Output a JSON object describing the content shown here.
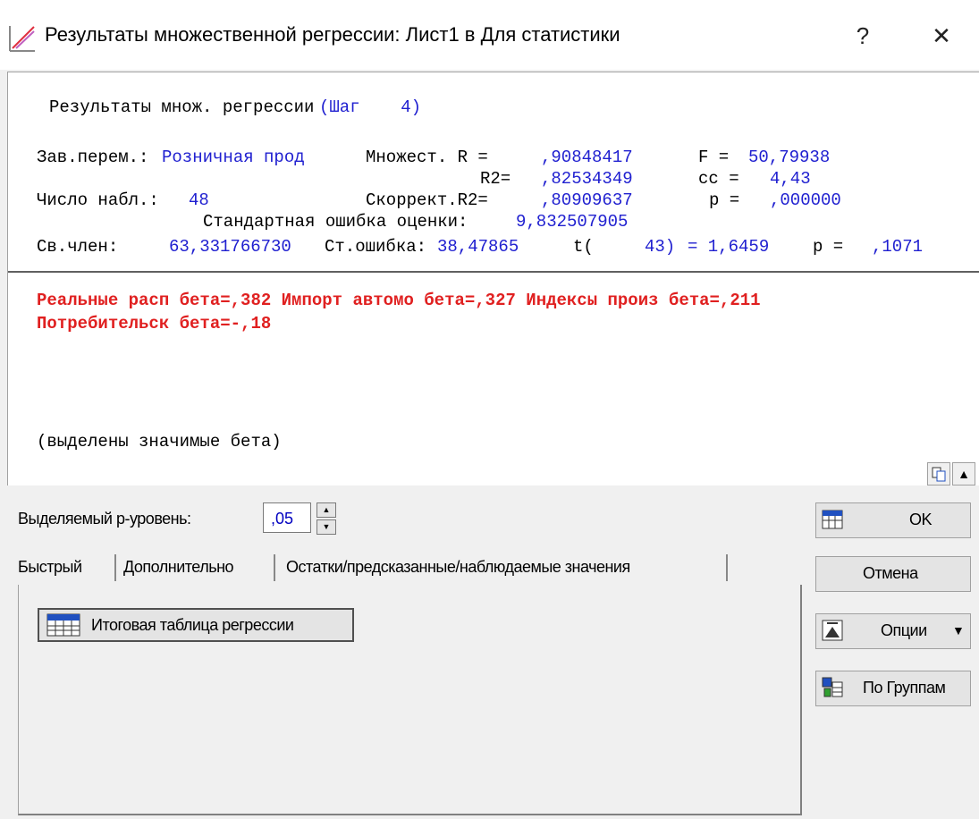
{
  "window": {
    "title": "Результаты множественной регрессии: Лист1 в Для статистики",
    "help_glyph": "?",
    "close_glyph": "✕"
  },
  "output": {
    "header": {
      "label": "Результаты множ. регрессии",
      "step": "(Шаг    4)"
    },
    "dep_var": {
      "label": "Зав.перем.:",
      "value": "Розничная прод"
    },
    "multiple_r": {
      "label": "Множест. R =",
      "value": ",90848417"
    },
    "f": {
      "label": "F =",
      "value": "50,79938"
    },
    "r2": {
      "label": "R2=",
      "value": ",82534349"
    },
    "df": {
      "label": "сс =",
      "value": "4,43"
    },
    "n": {
      "label": "Число набл.:",
      "value": "48"
    },
    "adj_r2": {
      "label": "Скоррект.R2=",
      "value": ",80909637"
    },
    "p": {
      "label": "p =",
      "value": ",000000"
    },
    "std_err_est": {
      "label": "Стандартная ошибка оценки:",
      "value": "9,832507905"
    },
    "intercept": {
      "label": "Св.член:",
      "value": "63,331766730",
      "se_label": "Ст.ошибка:",
      "se_value": "38,47865",
      "t_label": "t(",
      "t_df": "43)",
      "t_value": "= 1,6459",
      "p_label": "p =",
      "p_value": ",1071"
    },
    "betas_line1": "Реальные расп бета=,382 Импорт автомо бета=,327 Индексы произ бета=,211",
    "betas_line2": "Потребительск бета=-,18",
    "note": "(выделены значимые бета)"
  },
  "controls": {
    "p_level_label": "Выделяемый р-уровень:",
    "p_level_value": ",05",
    "tabs": [
      "Быстрый",
      "Дополнительно",
      "Остатки/предсказанные/наблюдаемые значения"
    ],
    "summary_button": "Итоговая таблица регрессии",
    "ok_button": "OK",
    "cancel_button": "Отмена",
    "options_button": "Опции",
    "by_groups_button": "По Группам"
  }
}
